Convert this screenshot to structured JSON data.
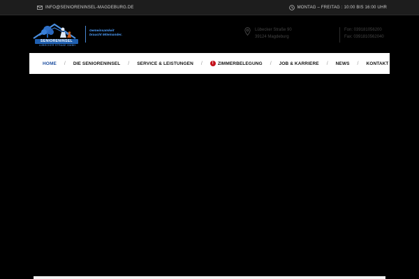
{
  "topbar": {
    "email": "INFO@SENIORENINSEL-MAGDEBURG.DE",
    "hours": "MONTAG – FREITAG : 10:00 BIS 16:00 UHR"
  },
  "logo": {
    "name": "SENIORENINSEL",
    "subline": "LÜBECKER STRAßE GMBH",
    "slogan_line1": "Gemeinsamkeit",
    "slogan_line2": "braucht Miteinander."
  },
  "contact": {
    "address_line1": "Lübecker Straße 90",
    "address_line2": "39124 Magdeburg",
    "phone": "Fon: 039181056200",
    "fax": "Fax: 039181056204​0"
  },
  "nav": {
    "items": [
      {
        "label": "HOME"
      },
      {
        "label": "DIE SENIORENINSEL"
      },
      {
        "label": "SERVICE & LEISTUNGEN"
      },
      {
        "label": "ZIMMERBELEGUNG",
        "badge": "!"
      },
      {
        "label": "JOB & KARRIERE"
      },
      {
        "label": "NEWS"
      },
      {
        "label": "KONTAKT"
      }
    ],
    "separator": "/"
  },
  "colors": {
    "accent": "#1e4fa0",
    "badge": "#c4101a"
  }
}
